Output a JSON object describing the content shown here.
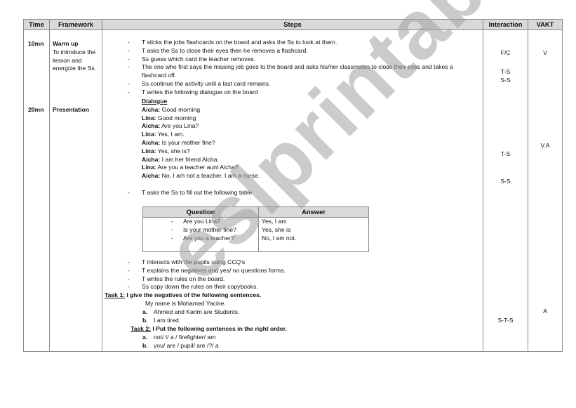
{
  "headers": {
    "time": "Time",
    "framework": "Framework",
    "steps": "Steps",
    "interaction": "Interaction",
    "vakt": "VAKT"
  },
  "stages": [
    {
      "time": "10mn",
      "title": "Warm up",
      "description": "To introduce the lesson and energize the Ss."
    },
    {
      "time": "20mn",
      "title": "Presentation",
      "description": ""
    }
  ],
  "warmup_steps": [
    "T sticks the jobs flashcards on the board and asks the Ss to look at them.",
    "T asks the Ss to close their eyes then he removes a flashcard.",
    "Ss guess which card the teacher removes.",
    "The one who first says the missing job goes to the board and asks his/her classmates to close their eyes and takes a flashcard off.",
    "Ss continue the activity until a last card remains.",
    "T writes the following dialogue on the board"
  ],
  "dialogue": {
    "title": "Dialogue",
    "lines": [
      {
        "speaker": "Aicha:",
        "text": " Good morning"
      },
      {
        "speaker": "Lina:",
        "text": " Good morning"
      },
      {
        "speaker": "Aicha:",
        "text": " Are you Lina?"
      },
      {
        "speaker": "Lina:",
        "text": "  Yes, I am."
      },
      {
        "speaker": "Aicha:",
        "text": " Is your mother fine?"
      },
      {
        "speaker": "Lina:",
        "text": " Yes, she is?"
      },
      {
        "speaker": "Aicha:",
        "text": " I am her friend Aicha."
      },
      {
        "speaker": "Lina:",
        "text": " Are you a teacher aunt Aicha?"
      },
      {
        "speaker": "Aicha:",
        "text": " No, I am not a teacher. I am a nurse."
      }
    ]
  },
  "fill_table_step": "T asks the Ss to fill out the following table",
  "qa_table": {
    "question_header": "Question",
    "answer_header": "Answer",
    "questions": [
      "Are you Lina?",
      "Is your mother fine?",
      "Are you a teacher?"
    ],
    "answers": [
      "Yes, I am",
      "Yes, she is",
      "No, I am not."
    ]
  },
  "presentation_steps": [
    "T interacts with the pupils using CCQ's",
    "T explains the negatives and yes/ no questions forms.",
    "T writes the rules on the board.",
    "Ss copy down the rules on their copybooks."
  ],
  "task1": {
    "label": "Task 1:",
    "instruction": " I give the negatives of the following sentences.",
    "example": "My name is Mohamed Yacine.",
    "items": [
      {
        "label": "a.",
        "text": "Ahmed and Karim are Students."
      },
      {
        "label": "b.",
        "text": "I am tired."
      }
    ]
  },
  "task2": {
    "label": "Task 2:",
    "instruction": " I Put the following sentences in the right order.",
    "items": [
      {
        "label": "a.",
        "text": "not/ I/ a / firefighter/ am"
      },
      {
        "label": "b.",
        "text": "you/ are / pupil/ are /?/ a"
      }
    ]
  },
  "interaction": {
    "warmup_1": "F/C",
    "warmup_2": "T-S",
    "warmup_3": "S-S",
    "presentation_1": "T-S",
    "presentation_2": "S-S",
    "presentation_3": "S-T-S"
  },
  "vakt": {
    "warmup": "V",
    "presentation": "V.A",
    "tasks": "A"
  },
  "watermark": "eslprintables.com"
}
